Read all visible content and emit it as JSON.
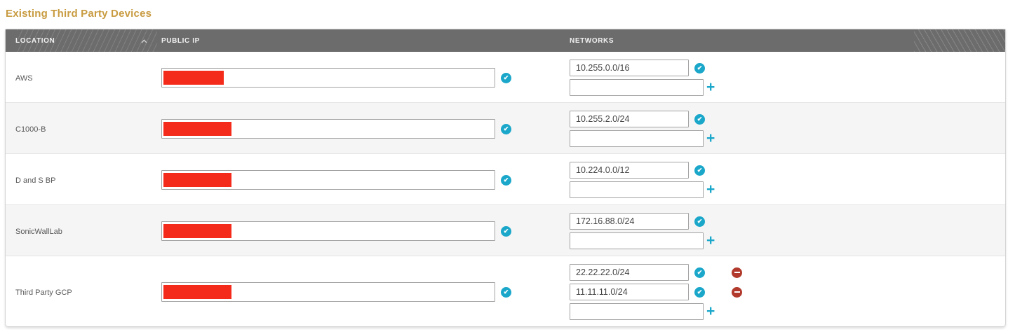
{
  "title": "Existing Third Party Devices",
  "colors": {
    "accent_gold": "#c89b40",
    "header_bg": "#6c6c6c",
    "teal": "#1ba7ca",
    "redaction_red": "#f42b1b",
    "minus_red": "#b13a2c",
    "row_alt_bg": "#f5f5f5"
  },
  "icons": {
    "verified": "check-circle",
    "add": "plus",
    "remove": "minus-circle",
    "sort": "chevron-up"
  },
  "table": {
    "columns": [
      {
        "label": "LOCATION",
        "sort": "asc"
      },
      {
        "label": "PUBLIC IP"
      },
      {
        "label": "NETWORKS"
      }
    ],
    "rows": [
      {
        "location": "AWS",
        "public_ip": {
          "value": "",
          "redacted": true,
          "verified": true
        },
        "networks": [
          {
            "value": "10.255.0.0/16",
            "verified": true,
            "removable": false
          }
        ],
        "new_network_value": ""
      },
      {
        "location": "C1000-B",
        "public_ip": {
          "value": "",
          "redacted": true,
          "verified": true
        },
        "networks": [
          {
            "value": "10.255.2.0/24",
            "verified": true,
            "removable": false
          }
        ],
        "new_network_value": ""
      },
      {
        "location": "D and S BP",
        "public_ip": {
          "value": "",
          "redacted": true,
          "verified": true
        },
        "networks": [
          {
            "value": "10.224.0.0/12",
            "verified": true,
            "removable": false
          }
        ],
        "new_network_value": ""
      },
      {
        "location": "SonicWallLab",
        "public_ip": {
          "value": "",
          "redacted": true,
          "verified": true
        },
        "networks": [
          {
            "value": "172.16.88.0/24",
            "verified": true,
            "removable": false
          }
        ],
        "new_network_value": ""
      },
      {
        "location": "Third Party GCP",
        "public_ip": {
          "value": "",
          "redacted": true,
          "verified": true
        },
        "networks": [
          {
            "value": "22.22.22.0/24",
            "verified": true,
            "removable": true
          },
          {
            "value": "11.11.11.0/24",
            "verified": true,
            "removable": true
          }
        ],
        "new_network_value": ""
      }
    ]
  }
}
